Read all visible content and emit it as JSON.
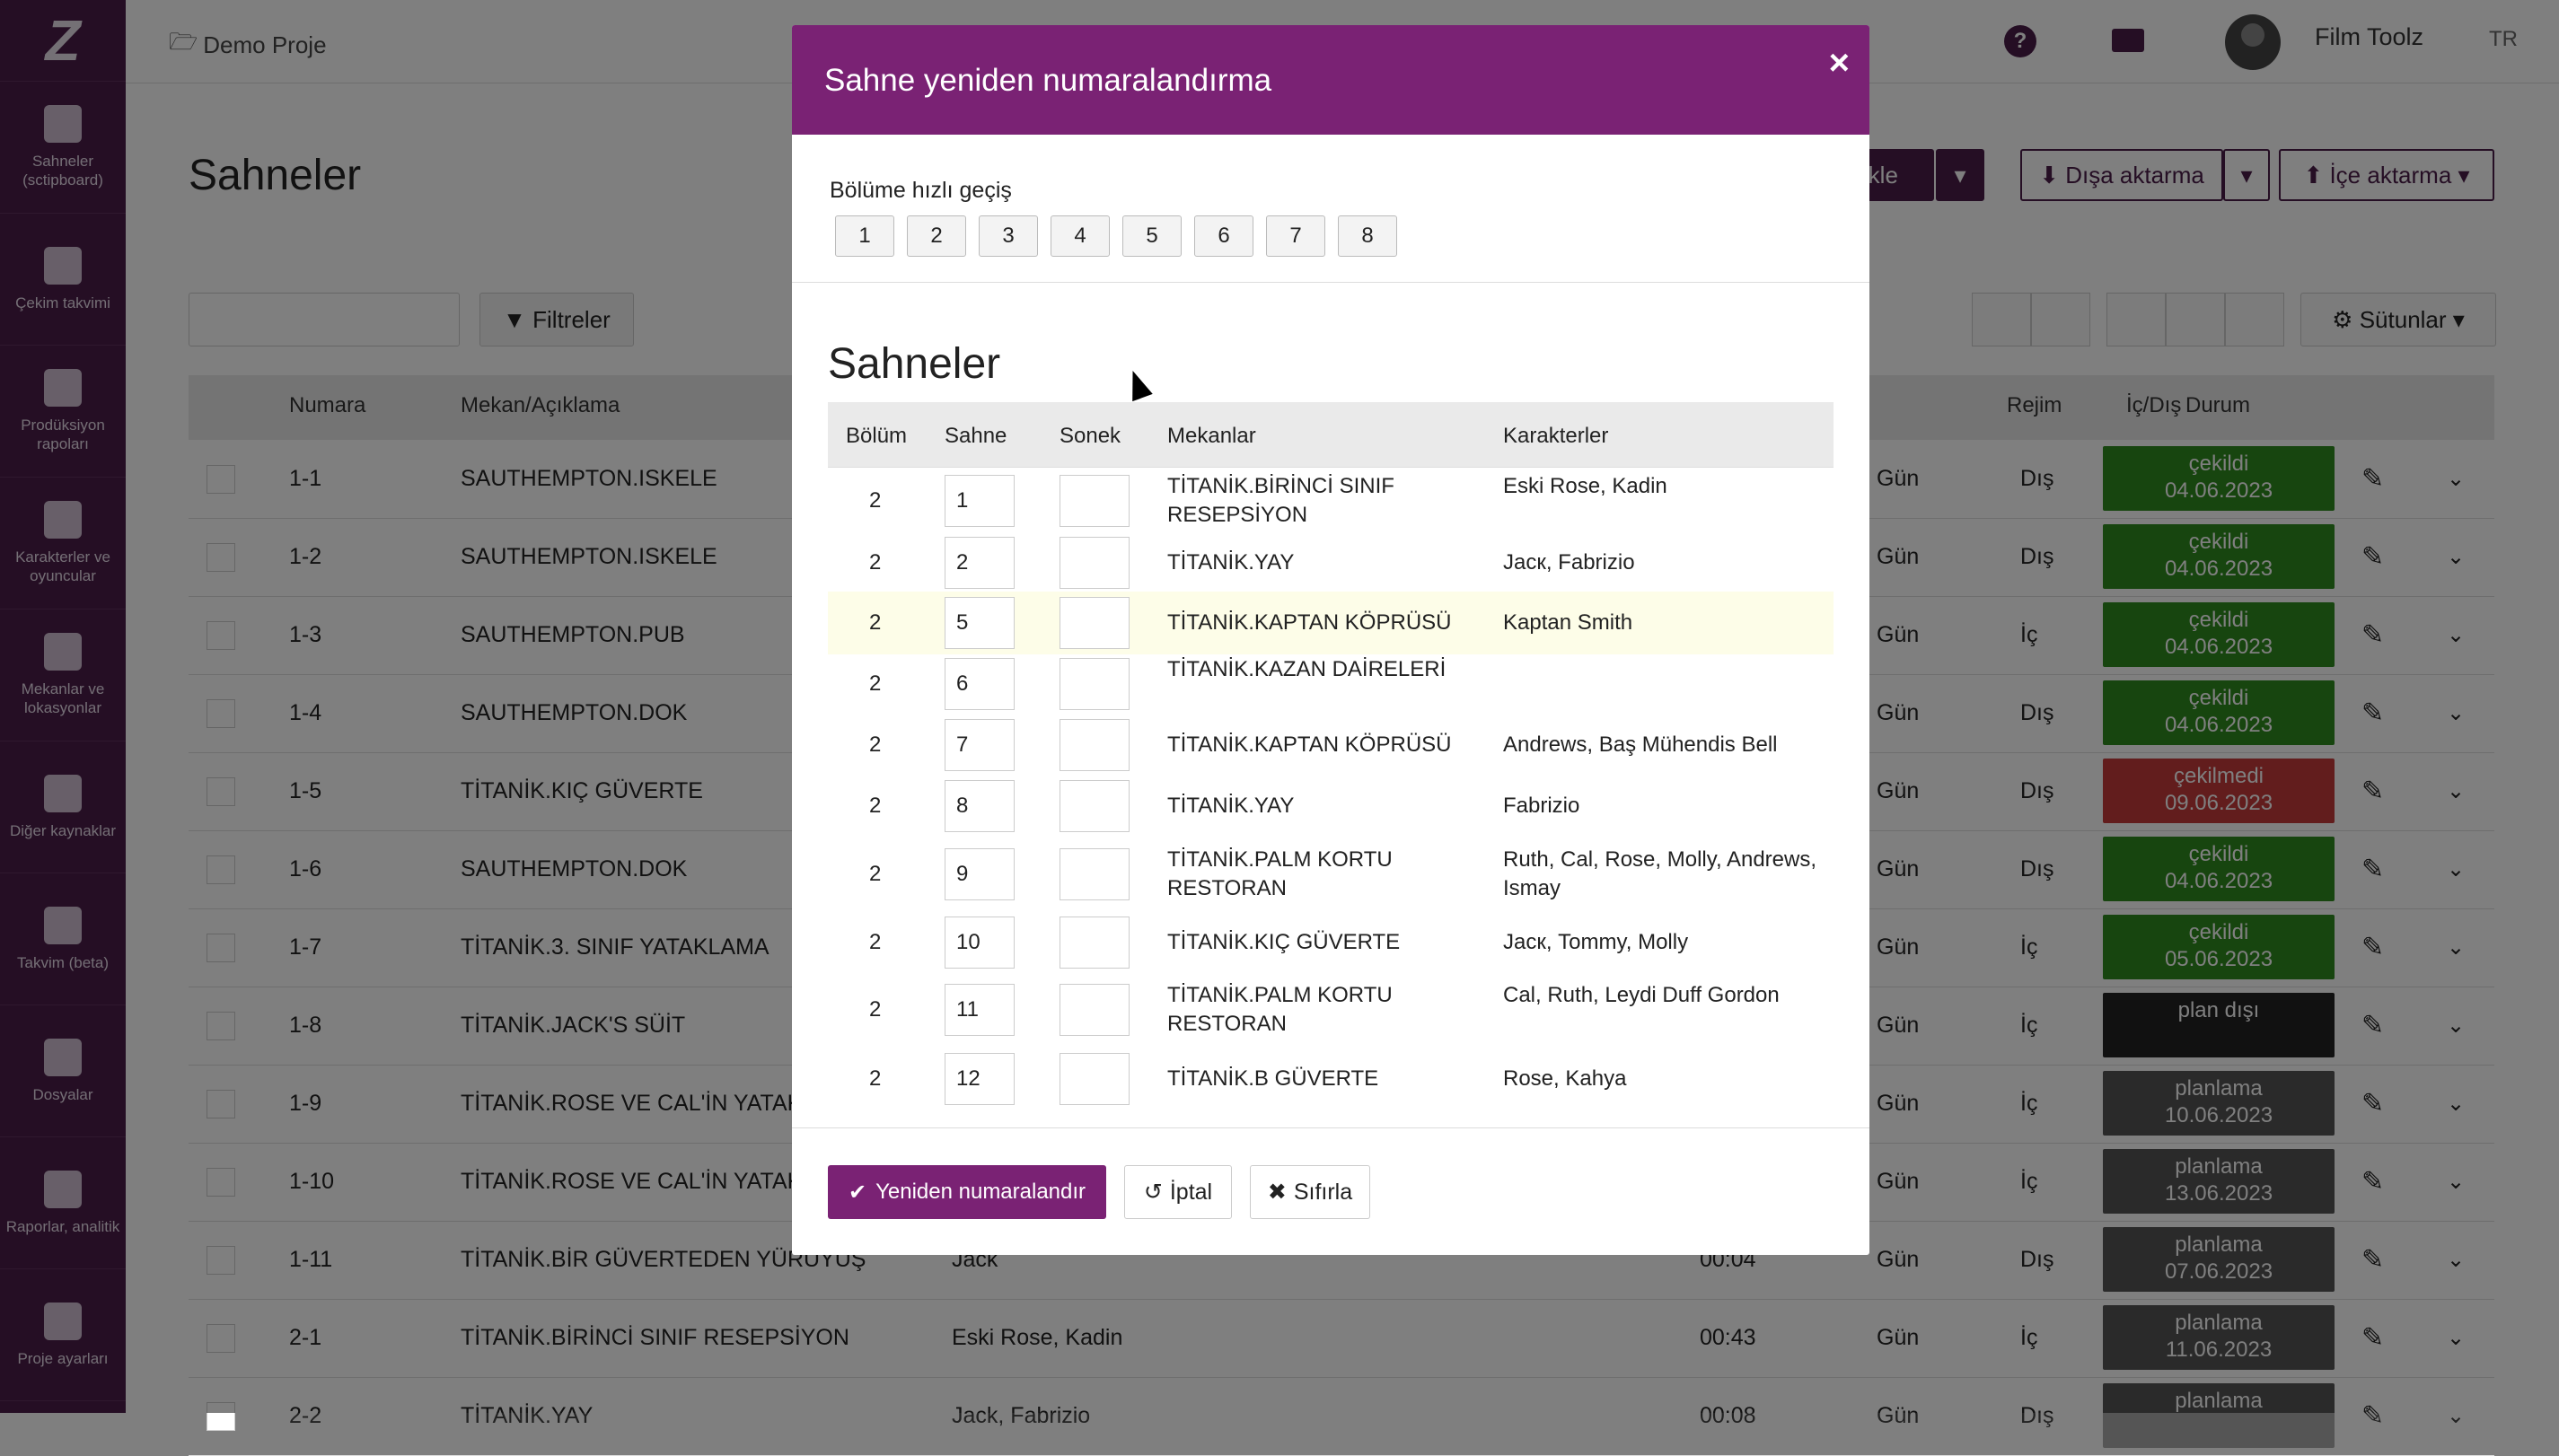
{
  "sidebar": {
    "logo": "Z",
    "items": [
      {
        "icon": "clapperboard-icon",
        "label": "Sahneler (sctipboard)"
      },
      {
        "icon": "calendar-icon",
        "label": "Çekim takvimi"
      },
      {
        "icon": "checkbox-icon",
        "label": "Prodüksiyon rapoları"
      },
      {
        "icon": "people-icon",
        "label": "Karakterler ve oyuncular"
      },
      {
        "icon": "image-icon",
        "label": "Mekanlar ve lokasyonlar"
      },
      {
        "icon": "archive-icon",
        "label": "Diğer kaynaklar"
      },
      {
        "icon": "calendar-icon",
        "label": "Takvim (beta)"
      },
      {
        "icon": "document-icon",
        "label": "Dosyalar"
      },
      {
        "icon": "chart-icon",
        "label": "Raporlar, analitik"
      },
      {
        "icon": "sliders-icon",
        "label": "Proje ayarları"
      }
    ]
  },
  "topbar": {
    "project": "Demo Proje",
    "user": "Film Toolz",
    "lang": "TR",
    "help": "?"
  },
  "page": {
    "title": "Sahneler",
    "add_scene": "ne ekle",
    "export": "Dışa aktarma",
    "import": "İçe aktarma",
    "filters": "Filtreler",
    "columns": "Sütunlar",
    "headers": {
      "number": "Numara",
      "location": "Mekan/Açıklama",
      "mode": "Rejim",
      "inout": "İç/Dış",
      "status": "Durum"
    },
    "rows": [
      {
        "num": "1-1",
        "loc": "SAUTHEMPTON.ISKELE",
        "mode": "Gün",
        "io": "Dış",
        "status": "çekildi",
        "date": "04.06.2023",
        "color": "#2e8b1e"
      },
      {
        "num": "1-2",
        "loc": "SAUTHEMPTON.ISKELE",
        "mode": "Gün",
        "io": "Dış",
        "status": "çekildi",
        "date": "04.06.2023",
        "color": "#2e8b1e"
      },
      {
        "num": "1-3",
        "loc": "SAUTHEMPTON.PUB",
        "mode": "Gün",
        "io": "İç",
        "status": "çekildi",
        "date": "04.06.2023",
        "color": "#2e8b1e"
      },
      {
        "num": "1-4",
        "loc": "SAUTHEMPTON.DOK",
        "mode": "Gün",
        "io": "Dış",
        "status": "çekildi",
        "date": "04.06.2023",
        "color": "#2e8b1e"
      },
      {
        "num": "1-5",
        "loc": "TİTANİK.KIÇ GÜVERTE",
        "mode": "Gün",
        "io": "Dış",
        "status": "çekilmedi",
        "date": "09.06.2023",
        "color": "#c43a3a"
      },
      {
        "num": "1-6",
        "loc": "SAUTHEMPTON.DOK",
        "mode": "Gün",
        "io": "Dış",
        "status": "çekildi",
        "date": "04.06.2023",
        "color": "#2e8b1e"
      },
      {
        "num": "1-7",
        "loc": "TİTANİK.3. SINIF YATAKLAMA",
        "mode": "Gün",
        "io": "İç",
        "status": "çekildi",
        "date": "05.06.2023",
        "color": "#2e8b1e"
      },
      {
        "num": "1-8",
        "loc": "TİTANİK.JACK'S SÜİT",
        "mode": "Gün",
        "io": "İç",
        "status": "plan dışı",
        "date": "",
        "color": "#222222"
      },
      {
        "num": "1-9",
        "loc": "TİTANİK.ROSE VE CAL'İN YATAK OI",
        "mode": "Gün",
        "io": "İç",
        "status": "planlama",
        "date": "10.06.2023",
        "color": "#555555"
      },
      {
        "num": "1-10",
        "loc": "TİTANİK.ROSE VE CAL'İN YATAK OI",
        "mode": "Gün",
        "io": "İç",
        "status": "planlama",
        "date": "13.06.2023",
        "color": "#555555"
      },
      {
        "num": "1-11",
        "loc": "TİTANİK.BİR GÜVERTEDEN YÜRÜYÜŞ",
        "extra": "Jack",
        "time": "00:04",
        "mode": "Gün",
        "io": "Dış",
        "status": "planlama",
        "date": "07.06.2023",
        "color": "#555555"
      },
      {
        "num": "2-1",
        "loc": "TİTANİK.BİRİNCİ SINIF RESEPSİYON",
        "extra": "Eski Rose, Kadin",
        "time": "00:43",
        "mode": "Gün",
        "io": "İç",
        "status": "planlama",
        "date": "11.06.2023",
        "color": "#555555"
      },
      {
        "num": "2-2",
        "loc": "TİTANİK.YAY",
        "extra": "Jack, Fabrizio",
        "time": "00:08",
        "mode": "Gün",
        "io": "Dış",
        "status": "planlama",
        "date": "",
        "color": "#555555"
      }
    ]
  },
  "modal": {
    "title": "Sahne yeniden numaralandırma",
    "close": "×",
    "quick_label": "Bölüme hızlı geçiş",
    "quick_buttons": [
      "1",
      "2",
      "3",
      "4",
      "5",
      "6",
      "7",
      "8"
    ],
    "subtitle": "Sahneler",
    "headers": {
      "episode": "Bölüm",
      "scene": "Sahne",
      "suffix": "Sonek",
      "locations": "Mekanlar",
      "characters": "Karakterler"
    },
    "rows": [
      {
        "ep": "2",
        "scene": "1",
        "loc": "TİTANİK.BİRİNCİ SINIF RESEPSİYON",
        "chars": "Eski Rose, Kadin"
      },
      {
        "ep": "2",
        "scene": "2",
        "loc": "TİTANİK.YAY",
        "chars": "Jacк, Fabrizio"
      },
      {
        "ep": "2",
        "scene": "5",
        "loc": "TİTANİK.KAPTAN KÖPRÜSÜ",
        "chars": "Kaptan Smith",
        "hl": true
      },
      {
        "ep": "2",
        "scene": "6",
        "loc": "TİTANİK.KAZAN DAİRELERİ",
        "chars": ""
      },
      {
        "ep": "2",
        "scene": "7",
        "loc": "TİTANİK.KAPTAN KÖPRÜSÜ",
        "chars": "Andrews, Baş Mühendis Bell"
      },
      {
        "ep": "2",
        "scene": "8",
        "loc": "TİTANİK.YAY",
        "chars": "Fabrizio"
      },
      {
        "ep": "2",
        "scene": "9",
        "loc": "TİTANİK.PALM KORTU RESTORAN",
        "chars": "Ruth, Cal, Rose, Molly, Andrews, Ismay"
      },
      {
        "ep": "2",
        "scene": "10",
        "loc": "TİTANİK.KIÇ GÜVERTE",
        "chars": "Jacк, Tommy, Molly"
      },
      {
        "ep": "2",
        "scene": "11",
        "loc": "TİTANİK.PALM KORTU RESTORAN",
        "chars": "Cal, Ruth, Leydi Duff Gordon"
      },
      {
        "ep": "2",
        "scene": "12",
        "loc": "TİTANİK.B GÜVERTE",
        "chars": "Rose, Kahya"
      }
    ],
    "renumber": "Yeniden numaralandır",
    "cancel": "İptal",
    "reset": "Sıfırla"
  }
}
